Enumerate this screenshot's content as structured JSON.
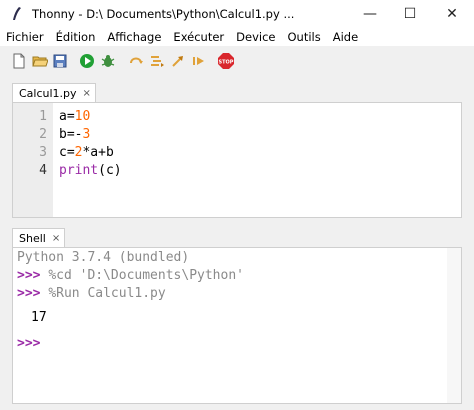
{
  "window": {
    "title": "Thonny  -  D:\\ Documents\\Python\\Calcul1.py  ...",
    "minimize_glyph": "—",
    "maximize_glyph": "☐",
    "close_glyph": "✕"
  },
  "menu": [
    "Fichier",
    "Édition",
    "Affichage",
    "Exécuter",
    "Device",
    "Outils",
    "Aide"
  ],
  "toolbar": {
    "icons": [
      "new-file-icon",
      "open-file-icon",
      "save-icon",
      "run-icon",
      "debug-icon",
      "step-over-icon",
      "step-into-icon",
      "step-out-icon",
      "resume-icon",
      "stop-icon"
    ],
    "stop_label": "STOP"
  },
  "editor": {
    "tab_label": "Calcul1.py",
    "tab_close": "×",
    "line_numbers": [
      "1",
      "2",
      "3",
      "4"
    ],
    "lines": [
      "a=10",
      "b=-3",
      "c=2*a+b",
      "print(c)"
    ]
  },
  "shell": {
    "tab_label": "Shell",
    "tab_close": "×",
    "version": "Python 3.7.4 (bundled)",
    "prompt": ">>>",
    "cmd1": "%cd 'D:\\Documents\\Python'",
    "cmd2": "%Run Calcul1.py",
    "output": "17"
  },
  "colors": {
    "number": "#ff6600",
    "builtin": "#9a2aa6",
    "prompt": "#9a2aa6",
    "stop_red": "#d9262c",
    "run_green": "#21a035"
  }
}
